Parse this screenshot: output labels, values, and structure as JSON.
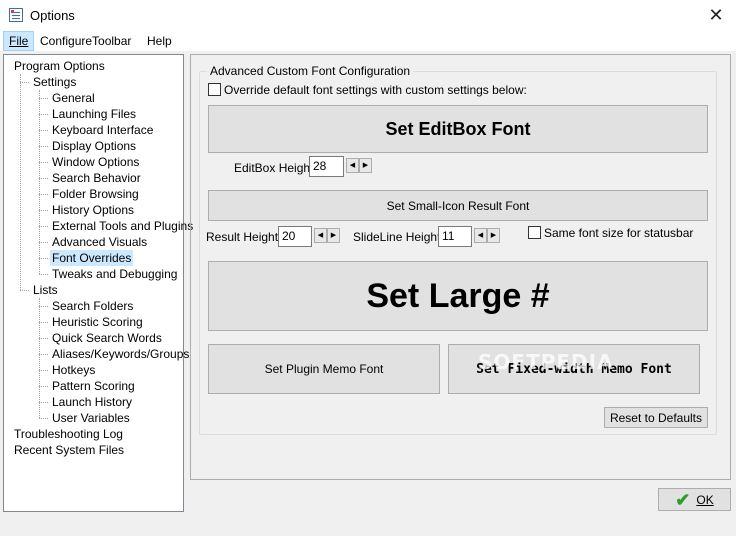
{
  "window": {
    "title": "Options",
    "close_glyph": "✕",
    "icon": "options-app-icon"
  },
  "menu": {
    "items": [
      "File",
      "ConfigureToolbar",
      "Help"
    ]
  },
  "tree": {
    "items": [
      {
        "label": "Program Options",
        "level": 0
      },
      {
        "label": "Settings",
        "level": 1
      },
      {
        "label": "General",
        "level": 2
      },
      {
        "label": "Launching Files",
        "level": 2
      },
      {
        "label": "Keyboard Interface",
        "level": 2
      },
      {
        "label": "Display Options",
        "level": 2
      },
      {
        "label": "Window Options",
        "level": 2
      },
      {
        "label": "Search Behavior",
        "level": 2
      },
      {
        "label": "Folder Browsing",
        "level": 2
      },
      {
        "label": "History Options",
        "level": 2
      },
      {
        "label": "External Tools and Plugins",
        "level": 2
      },
      {
        "label": "Advanced Visuals",
        "level": 2
      },
      {
        "label": "Font Overrides",
        "level": 2,
        "selected": true
      },
      {
        "label": "Tweaks and Debugging",
        "level": 2
      },
      {
        "label": "Lists",
        "level": 1
      },
      {
        "label": "Search Folders",
        "level": 2
      },
      {
        "label": "Heuristic Scoring",
        "level": 2
      },
      {
        "label": "Quick Search Words",
        "level": 2
      },
      {
        "label": "Aliases/Keywords/Groups",
        "level": 2
      },
      {
        "label": "Hotkeys",
        "level": 2
      },
      {
        "label": "Pattern Scoring",
        "level": 2
      },
      {
        "label": "Launch History",
        "level": 2
      },
      {
        "label": "User Variables",
        "level": 2
      },
      {
        "label": "Troubleshooting Log",
        "level": 0
      },
      {
        "label": "Recent System Files",
        "level": 0
      }
    ]
  },
  "font_panel": {
    "group_title": "Advanced Custom Font Configuration",
    "override_label": "Override default font settings with custom settings below:",
    "override_checked": false,
    "editbox_font_button": "Set EditBox Font",
    "editbox_height_label": "EditBox Height:",
    "editbox_height_value": "28",
    "small_icon_font_button": "Set Small-Icon Result Font",
    "result_height_label": "Result Height:",
    "result_height_value": "20",
    "slideline_height_label": "SlideLine Height:",
    "slideline_height_value": "11",
    "same_font_label": "Same font size for statusbar",
    "same_font_checked": false,
    "large_font_button": "Set Large #",
    "plugin_memo_button": "Set Plugin Memo Font",
    "fixed_width_button": "Set Fixed-width Memo Font",
    "reset_button": "Reset to Defaults"
  },
  "watermark": "SOFTPEDIA",
  "footer": {
    "ok_label": "OK"
  },
  "colors": {
    "selection": "#cce8ff",
    "ok_check": "#2a9d2a"
  }
}
